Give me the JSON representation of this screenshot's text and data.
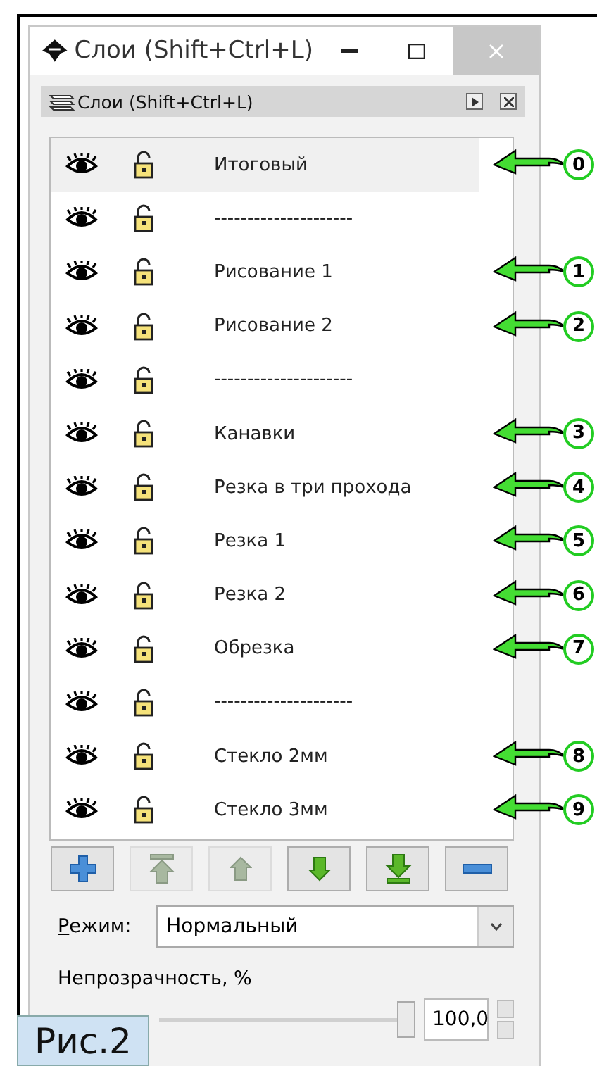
{
  "window": {
    "title": "Слои (Shift+Ctrl+L)"
  },
  "panel": {
    "title": "Слои (Shift+Ctrl+L)"
  },
  "layers": [
    {
      "label": "Итоговый",
      "visible": true,
      "locked": false,
      "selected": true,
      "marker": "0"
    },
    {
      "label": "---------------------",
      "visible": true,
      "locked": false,
      "selected": false
    },
    {
      "label": "Рисование 1",
      "visible": true,
      "locked": false,
      "selected": false,
      "marker": "1"
    },
    {
      "label": "Рисование 2",
      "visible": true,
      "locked": false,
      "selected": false,
      "marker": "2"
    },
    {
      "label": "---------------------",
      "visible": true,
      "locked": false,
      "selected": false
    },
    {
      "label": "Канавки",
      "visible": true,
      "locked": false,
      "selected": false,
      "marker": "3"
    },
    {
      "label": "Резка в три прохода",
      "visible": true,
      "locked": false,
      "selected": false,
      "marker": "4"
    },
    {
      "label": "Резка 1",
      "visible": true,
      "locked": false,
      "selected": false,
      "marker": "5"
    },
    {
      "label": "Резка 2",
      "visible": true,
      "locked": false,
      "selected": false,
      "marker": "6"
    },
    {
      "label": "Обрезка",
      "visible": true,
      "locked": false,
      "selected": false,
      "marker": "7"
    },
    {
      "label": "---------------------",
      "visible": true,
      "locked": false,
      "selected": false
    },
    {
      "label": "Стекло 2мм",
      "visible": true,
      "locked": false,
      "selected": false,
      "marker": "8"
    },
    {
      "label": "Стекло 3мм",
      "visible": true,
      "locked": false,
      "selected": false,
      "marker": "9"
    }
  ],
  "toolbar": [
    {
      "kind": "add",
      "disabled": false
    },
    {
      "kind": "top",
      "disabled": true
    },
    {
      "kind": "up",
      "disabled": true
    },
    {
      "kind": "down",
      "disabled": false
    },
    {
      "kind": "bottom",
      "disabled": false
    },
    {
      "kind": "remove",
      "disabled": false
    }
  ],
  "mode": {
    "label": "Режим:",
    "value": "Нормальный"
  },
  "opacity": {
    "label": "Непрозрачность, %",
    "level": 1.0,
    "value": "100,0"
  },
  "figure_label": "Рис.2"
}
